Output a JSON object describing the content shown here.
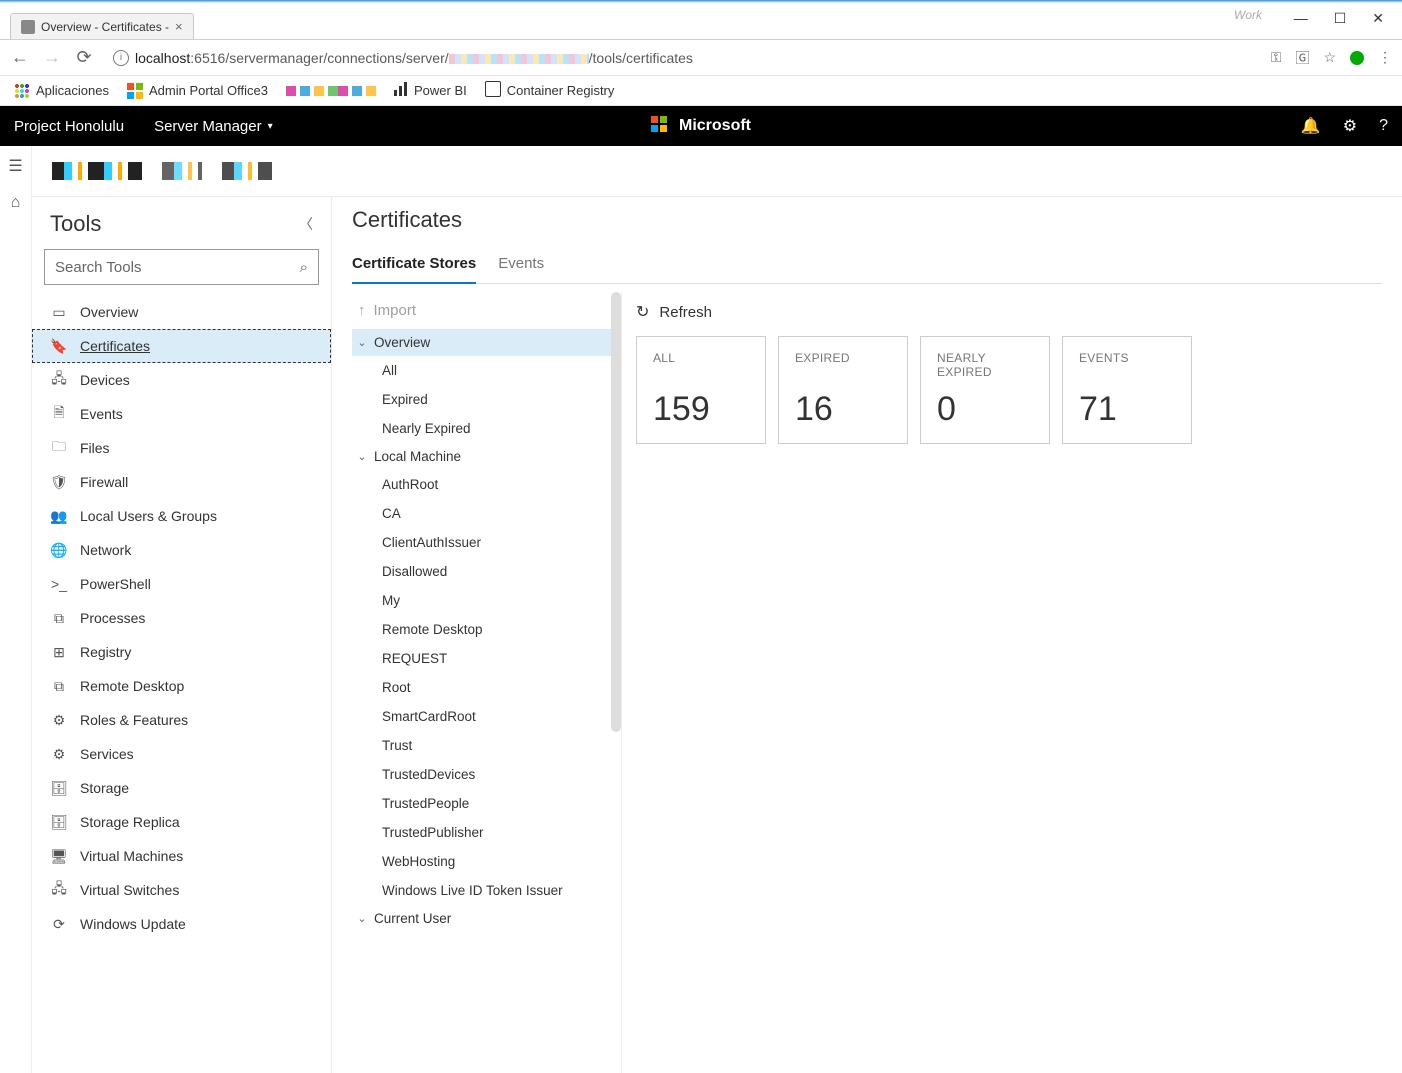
{
  "window": {
    "work_label": "Work",
    "tab_title": "Overview - Certificates -"
  },
  "nav": {
    "url_host": "localhost",
    "url_port": ":6516",
    "url_path1": "/servermanager/connections/server/",
    "url_path2": "/tools/certificates"
  },
  "bookmarks": {
    "apps": "Aplicaciones",
    "admin": "Admin Portal Office3",
    "pbi": "Power BI",
    "acr": "Container Registry"
  },
  "topbar": {
    "brand": "Project Honolulu",
    "menu": "Server Manager",
    "ms": "Microsoft"
  },
  "tools": {
    "title": "Tools",
    "search_placeholder": "Search Tools",
    "items": [
      "Overview",
      "Certificates",
      "Devices",
      "Events",
      "Files",
      "Firewall",
      "Local Users & Groups",
      "Network",
      "PowerShell",
      "Processes",
      "Registry",
      "Remote Desktop",
      "Roles & Features",
      "Services",
      "Storage",
      "Storage Replica",
      "Virtual Machines",
      "Virtual Switches",
      "Windows Update"
    ],
    "selected_index": 1
  },
  "cert": {
    "title": "Certificates",
    "tabs": [
      "Certificate Stores",
      "Events"
    ],
    "active_tab": 0,
    "import": "Import",
    "tree": {
      "overview": {
        "label": "Overview",
        "children": [
          "All",
          "Expired",
          "Nearly Expired"
        ]
      },
      "local_machine": {
        "label": "Local Machine",
        "children": [
          "AuthRoot",
          "CA",
          "ClientAuthIssuer",
          "Disallowed",
          "My",
          "Remote Desktop",
          "REQUEST",
          "Root",
          "SmartCardRoot",
          "Trust",
          "TrustedDevices",
          "TrustedPeople",
          "TrustedPublisher",
          "WebHosting",
          "Windows Live ID Token Issuer"
        ]
      },
      "current_user": {
        "label": "Current User"
      }
    },
    "refresh": "Refresh",
    "cards": [
      {
        "label": "ALL",
        "value": "159"
      },
      {
        "label": "EXPIRED",
        "value": "16"
      },
      {
        "label": "NEARLY EXPIRED",
        "value": "0"
      },
      {
        "label": "EVENTS",
        "value": "71"
      }
    ]
  }
}
